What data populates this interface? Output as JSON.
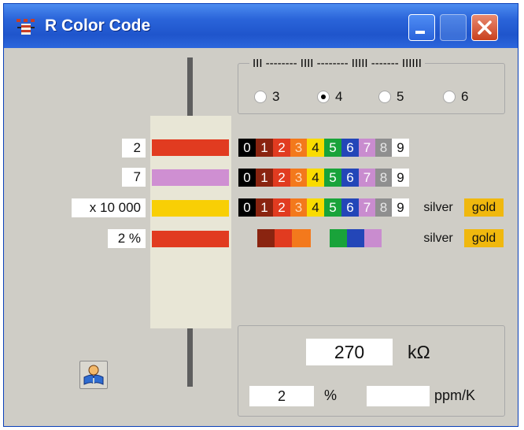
{
  "window": {
    "title": "R Color Code"
  },
  "bands_selector": {
    "legend": "III -------- IIII -------- IIIII ------- IIIIII",
    "options": [
      {
        "label": "3",
        "selected": false
      },
      {
        "label": "4",
        "selected": true
      },
      {
        "label": "5",
        "selected": false
      },
      {
        "label": "6",
        "selected": false
      }
    ]
  },
  "band_values": {
    "digit1": "2",
    "digit2": "7",
    "multiplier": "x 10 000",
    "tolerance": "2 %"
  },
  "band_colors": {
    "digit1": "#e13b20",
    "digit2": "#cf8fd2",
    "multiplier": "#f8cf05",
    "tolerance": "#e13b20"
  },
  "palette": {
    "digits": [
      {
        "label": "0",
        "bg": "#000000",
        "fg": "#ffffff"
      },
      {
        "label": "1",
        "bg": "#8a2410",
        "fg": "#ffffff"
      },
      {
        "label": "2",
        "bg": "#e13b20",
        "fg": "#ffffff"
      },
      {
        "label": "3",
        "bg": "#f3791c",
        "fg": "#ffd9b8"
      },
      {
        "label": "4",
        "bg": "#f9db00",
        "fg": "#111111"
      },
      {
        "label": "5",
        "bg": "#19a33a",
        "fg": "#ffffff"
      },
      {
        "label": "6",
        "bg": "#2346b8",
        "fg": "#ffffff"
      },
      {
        "label": "7",
        "bg": "#c98ccf",
        "fg": "#ffffff"
      },
      {
        "label": "8",
        "bg": "#8f8f8f",
        "fg": "#e7e7e7"
      },
      {
        "label": "9",
        "bg": "#ffffff",
        "fg": "#111111"
      }
    ],
    "silver_label": "silver",
    "gold_label": "gold",
    "gold_color": "#f0b80e"
  },
  "tolerance_colors": [
    "#8a2410",
    "#e13b20",
    "#f3791c",
    "#19a33a",
    "#2346b8",
    "#c98ccf"
  ],
  "result": {
    "resistance": "270",
    "resistance_unit": "kΩ",
    "tolerance": "2",
    "tolerance_unit": "%",
    "tempco": "",
    "tempco_unit": "ppm/K"
  },
  "icons": {
    "app": "resistor-icon",
    "help": "help-book-icon"
  }
}
